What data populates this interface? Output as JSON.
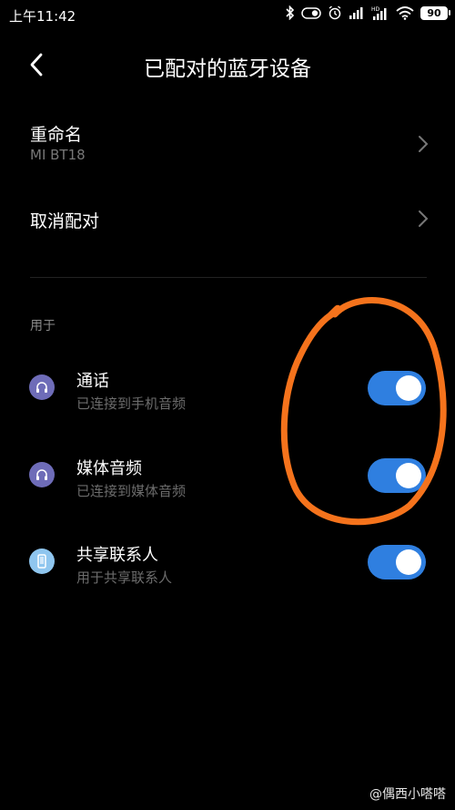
{
  "status_bar": {
    "time": "上午11:42",
    "icons": [
      "bluetooth-icon",
      "toggle-icon",
      "alarm-icon",
      "signal-icon",
      "hd-signal-icon",
      "wifi-icon",
      "battery-icon"
    ],
    "battery_level": "90"
  },
  "header": {
    "back_icon": "chevron-left-icon",
    "title": "已配对的蓝牙设备"
  },
  "rename": {
    "title": "重命名",
    "device_name": "MI BT18"
  },
  "unpair": {
    "title": "取消配对"
  },
  "section_label": "用于",
  "profiles": [
    {
      "title": "通话",
      "subtitle": "已连接到手机音频",
      "icon": "headphones-icon",
      "icon_color": "#6e6cb8",
      "enabled": true
    },
    {
      "title": "媒体音频",
      "subtitle": "已连接到媒体音频",
      "icon": "headphones-icon",
      "icon_color": "#6e6cb8",
      "enabled": true
    },
    {
      "title": "共享联系人",
      "subtitle": "用于共享联系人",
      "icon": "phone-device-icon",
      "icon_color": "#8fc6ef",
      "enabled": true
    }
  ],
  "colors": {
    "background": "#000000",
    "switch_on": "#2f7fe0",
    "annotation": "#f5731c"
  },
  "watermark": "@偶西小嗒嗒"
}
